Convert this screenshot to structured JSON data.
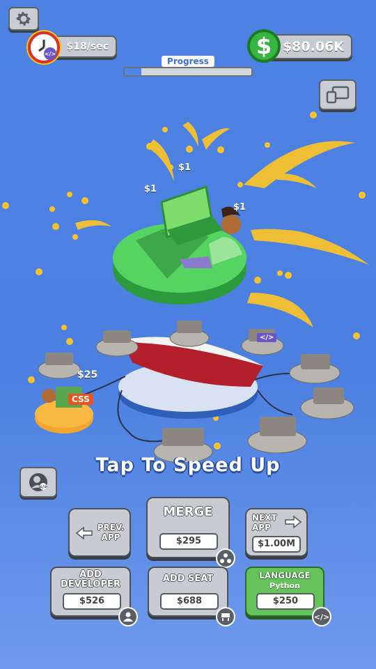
{
  "hud": {
    "rate": "$18/sec",
    "cash": "$80.06K",
    "cash_symbol": "$",
    "progress_label": "Progress",
    "progress_value": 0.13
  },
  "floating": {
    "coin1": "$1",
    "coin2": "$1",
    "coin3": "$1",
    "seat_price": "$25",
    "tag_css": "CSS",
    "tag_code": "</>"
  },
  "tap_prompt": "Tap To Speed Up",
  "buttons": {
    "prev_app": {
      "line1": "PREV.",
      "line2": "APP"
    },
    "merge": {
      "label": "MERGE",
      "price": "$295"
    },
    "next_app": {
      "line1": "NEXT",
      "line2": "APP",
      "price": "$1.00M"
    },
    "add_developer": {
      "line1": "ADD",
      "line2": "DEVELOPER",
      "price": "$526"
    },
    "add_seat": {
      "label": "ADD SEAT",
      "price": "$688"
    },
    "language": {
      "label": "LANGUAGE",
      "sub": "Python",
      "price": "$250",
      "icon": "</>"
    }
  },
  "colors": {
    "background": "#4b7fe0",
    "accent_green": "#66c25a",
    "dollar_green": "#36b640",
    "clock_red": "#d8332a"
  },
  "icons": [
    "gear-icon",
    "clock-code-icon",
    "dollar-icon",
    "devices-icon",
    "profile-icon",
    "arrow-left-icon",
    "arrow-right-icon",
    "merge-icon",
    "developer-icon",
    "seat-icon",
    "code-icon"
  ]
}
